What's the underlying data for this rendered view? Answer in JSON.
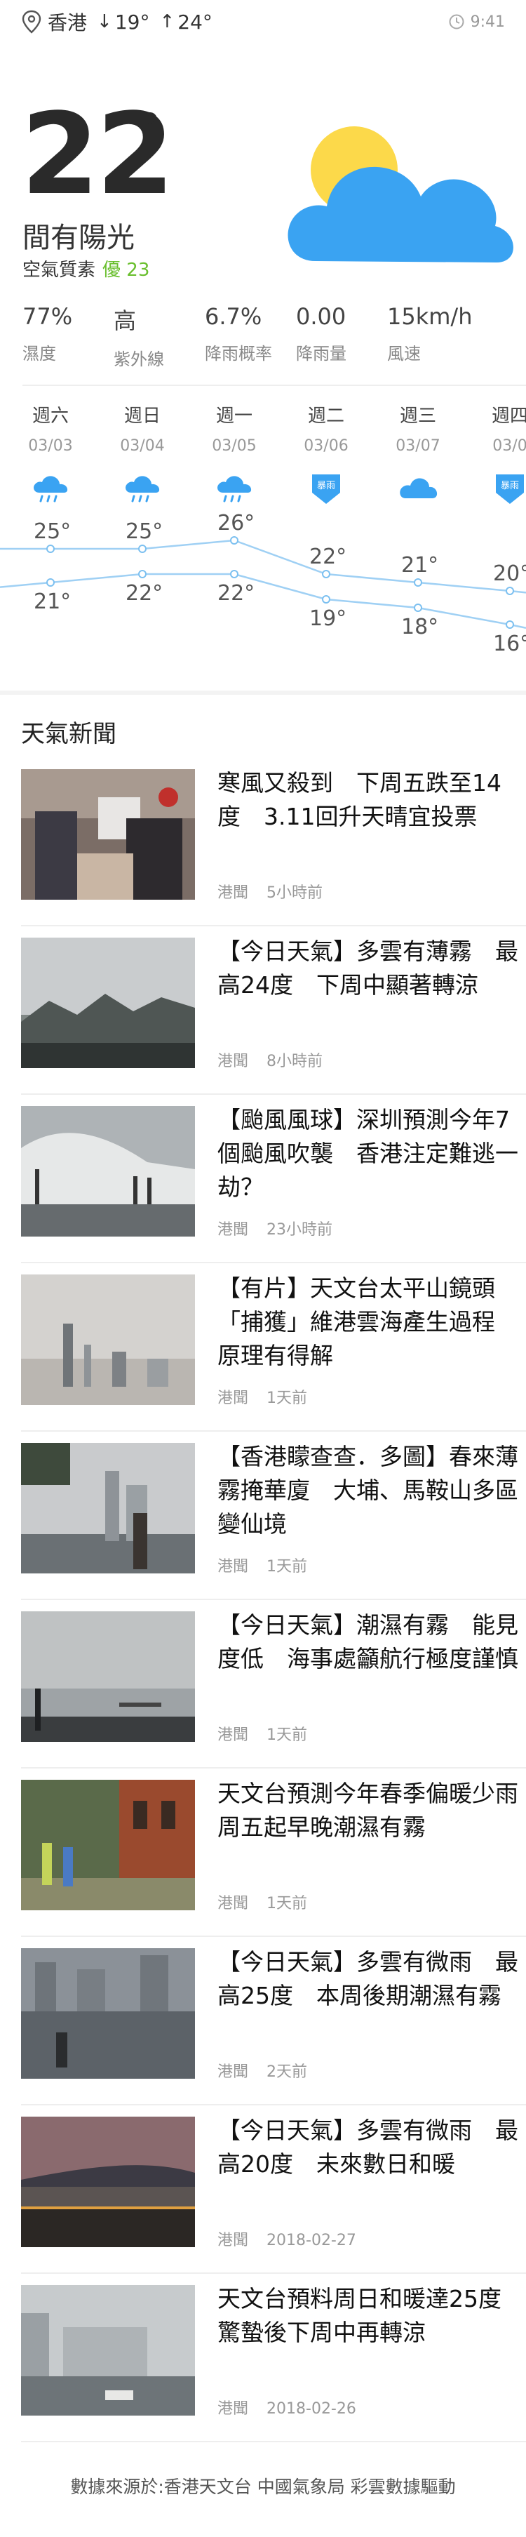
{
  "status": {
    "location": "香港",
    "low": "19°",
    "high": "24°",
    "low_arrow": "↓",
    "high_arrow": "↑",
    "time": "9:41"
  },
  "current": {
    "temp": "22",
    "degree": "°",
    "condition": "間有陽光",
    "aqi_label": "空氣質素",
    "aqi_value": "優 23"
  },
  "stats": [
    {
      "value": "77%",
      "label": "濕度"
    },
    {
      "value": "高",
      "label": "紫外線"
    },
    {
      "value": "6.7%",
      "label": "降雨概率"
    },
    {
      "value": "0.00",
      "label": "降雨量"
    },
    {
      "value": "15km/h",
      "label": "風速"
    }
  ],
  "forecast": [
    {
      "day": "週六",
      "date": "03/03",
      "icon": "cloud-rain-icon",
      "high": "25°",
      "low": "21°"
    },
    {
      "day": "週日",
      "date": "03/04",
      "icon": "cloud-rain-icon",
      "high": "25°",
      "low": "22°"
    },
    {
      "day": "週一",
      "date": "03/05",
      "icon": "cloud-rain-icon",
      "high": "26°",
      "low": "22°"
    },
    {
      "day": "週二",
      "date": "03/06",
      "icon": "rain-warning-icon",
      "high": "22°",
      "low": "19°"
    },
    {
      "day": "週三",
      "date": "03/07",
      "icon": "cloud-icon",
      "high": "21°",
      "low": "18°"
    },
    {
      "day": "週四",
      "date": "03/0",
      "icon": "rain-warning-icon",
      "high": "20°",
      "low": "16°"
    }
  ],
  "news_section_title": "天氣新聞",
  "news": [
    {
      "headline": "寒風又殺到　下周五跌至14度　3.11回升天晴宜投票",
      "source": "港聞",
      "time": "5小時前"
    },
    {
      "headline": "【今日天氣】多雲有薄霧　最高24度　下周中顯著轉涼",
      "source": "港聞",
      "time": "8小時前"
    },
    {
      "headline": "【颱風風球】深圳預測今年7個颱風吹襲　香港注定難逃一劫？",
      "source": "港聞",
      "time": "23小時前"
    },
    {
      "headline": "【有片】天文台太平山鏡頭「捕獲」維港雲海產生過程　原理有得解",
      "source": "港聞",
      "time": "1天前"
    },
    {
      "headline": "【香港矇查查．多圖】春來薄霧掩華廈　大埔、馬鞍山多區變仙境",
      "source": "港聞",
      "time": "1天前"
    },
    {
      "headline": "【今日天氣】潮濕有霧　能見度低　海事處籲航行極度謹慎",
      "source": "港聞",
      "time": "1天前"
    },
    {
      "headline": "天文台預測今年春季偏暖少雨　周五起早晚潮濕有霧",
      "source": "港聞",
      "time": "1天前"
    },
    {
      "headline": "【今日天氣】多雲有微雨　最高25度　本周後期潮濕有霧",
      "source": "港聞",
      "time": "2天前"
    },
    {
      "headline": "【今日天氣】多雲有微雨　最高20度　未來數日和暖",
      "source": "港聞",
      "time": "2018-02-27"
    },
    {
      "headline": "天文台預料周日和暖達25度　驚蟄後下周中再轉涼",
      "source": "港聞",
      "time": "2018-02-26"
    }
  ],
  "footer": "數據來源於:香港天文台 中國氣象局 彩雲數據驅動",
  "colors": {
    "accent_blue": "#3aa3f2",
    "sun": "#fcd94a",
    "aqi_good": "#6abf2e"
  }
}
